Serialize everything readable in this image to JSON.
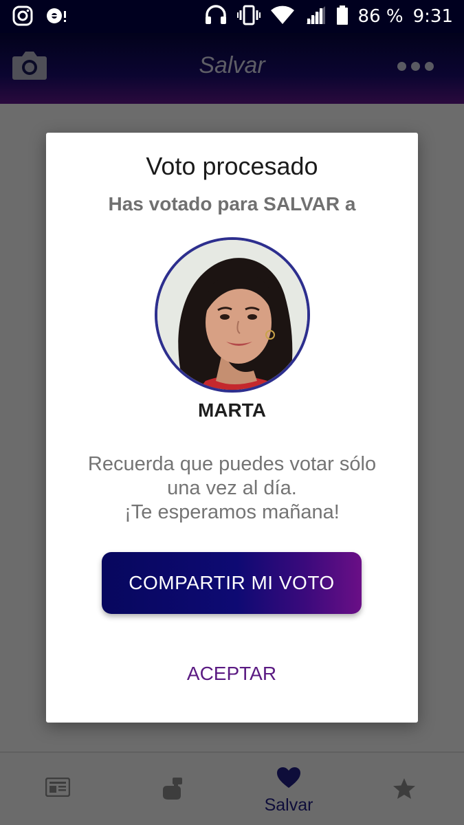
{
  "status_bar": {
    "icons_left": [
      "instagram-icon",
      "voice-message-icon"
    ],
    "icons_right": [
      "headphones-icon",
      "vibrate-icon",
      "wifi-icon",
      "signal-icon",
      "battery-icon"
    ],
    "battery": "86 %",
    "time": "9:31"
  },
  "app_bar": {
    "title": "Salvar",
    "left_icon": "camera-icon",
    "right_icon": "more-horizontal-icon"
  },
  "dialog": {
    "title": "Voto procesado",
    "subtitle": "Has votado para SALVAR a",
    "person_name": "MARTA",
    "message_line1": "Recuerda que puedes votar sólo",
    "message_line2": "una vez al día.",
    "message_line3": "¡Te esperamos mañana!",
    "share_label": "COMPARTIR MI VOTO",
    "accept_label": "ACEPTAR"
  },
  "bottom_nav": {
    "items": [
      {
        "icon": "news-icon",
        "label": ""
      },
      {
        "icon": "hand-vote-icon",
        "label": ""
      },
      {
        "icon": "heart-icon",
        "label": "Salvar",
        "active": true
      },
      {
        "icon": "star-icon",
        "label": ""
      }
    ]
  },
  "colors": {
    "status_bar_bg": "#00001f",
    "overlay_bg": "#6c6c6c",
    "accent_purple": "#5a1a82",
    "button_gradient_start": "#07075e",
    "button_gradient_end": "#6a0f86",
    "avatar_ring": "#2d2f8e",
    "active_nav": "#0e0d3a"
  }
}
